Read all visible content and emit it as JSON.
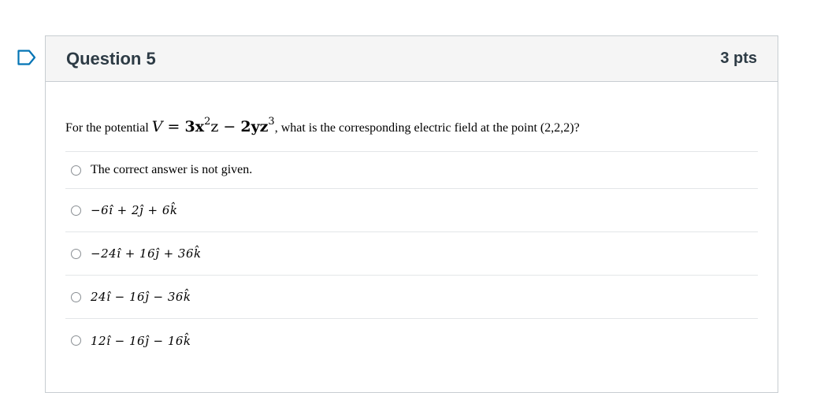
{
  "question": {
    "title": "Question 5",
    "points": "3 pts",
    "prompt_before": "For the potential ",
    "prompt_math": {
      "lhs": "V",
      "eq": " = ",
      "t1_coef": "3x",
      "t1_exp": "2",
      "t1_rest": "z",
      "minus": " − ",
      "t2_coef": "2yz",
      "t2_exp": "3"
    },
    "prompt_after": ", what is the corresponding electric field at the point (2,2,2)?",
    "answers": [
      {
        "text": "The correct answer is not given.",
        "type": "text"
      },
      {
        "text": "−6î + 2ĵ + 6k̂",
        "type": "math"
      },
      {
        "text": "−24î + 16ĵ + 36k̂",
        "type": "math"
      },
      {
        "text": "24î − 16ĵ − 36k̂",
        "type": "math"
      },
      {
        "text": "12î − 16ĵ − 16k̂",
        "type": "math"
      }
    ]
  },
  "icons": {
    "flag": "bookmark-flag-icon",
    "radio": "radio-button-icon"
  },
  "colors": {
    "flag": "#0374b5",
    "border": "#c7cdd1",
    "header_bg": "#f5f5f5"
  }
}
